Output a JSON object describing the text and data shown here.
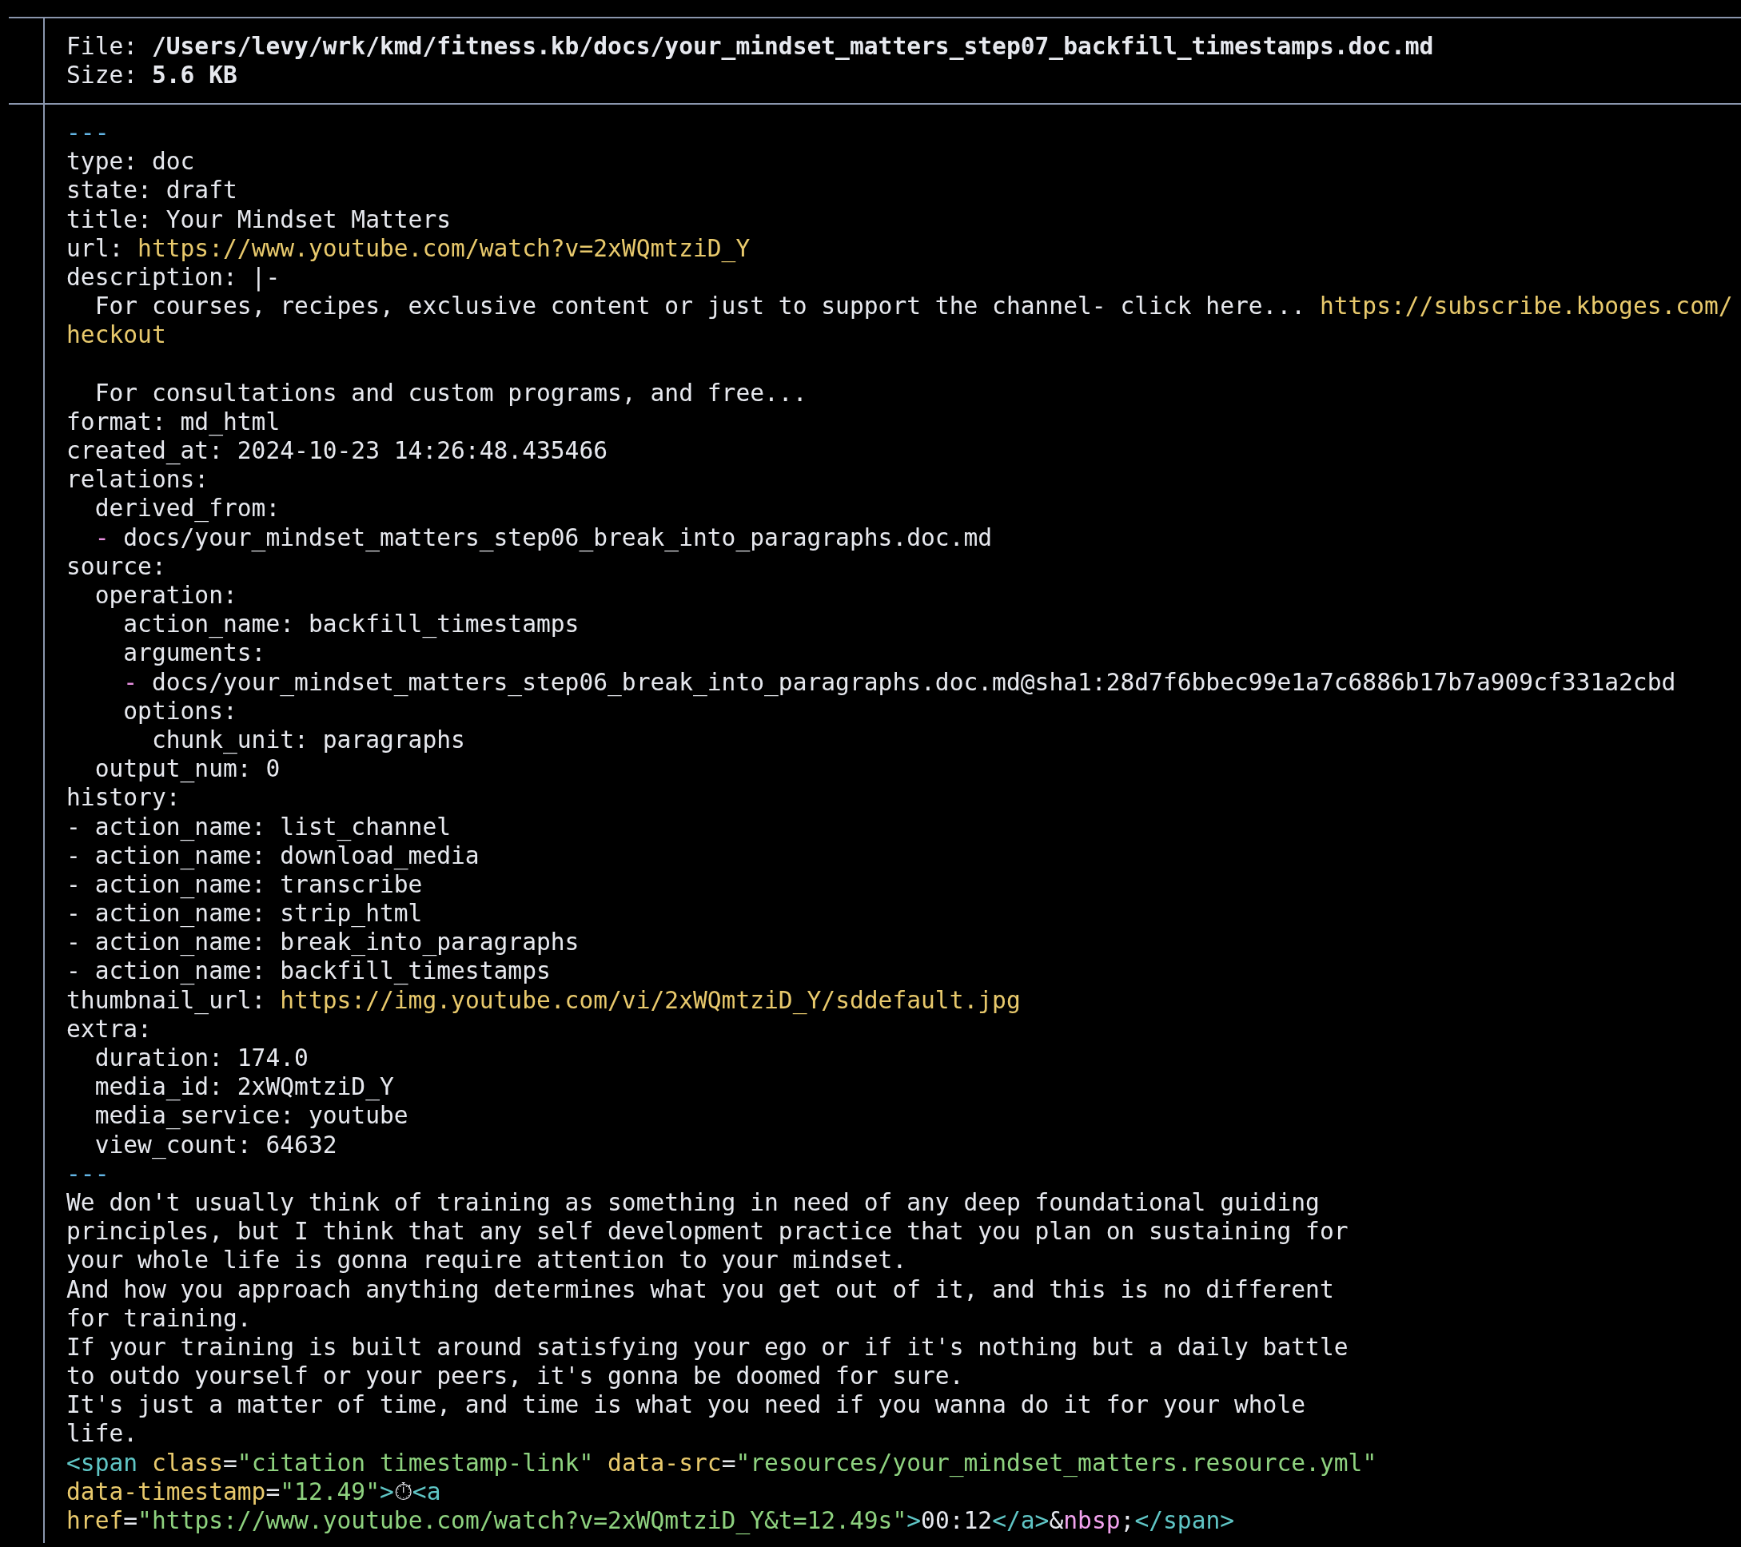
{
  "header": [
    {
      "label": "File:",
      "value": "/Users/levy/wrk/kmd/fitness.kb/docs/your_mindset_matters_step07_backfill_timestamps.doc.md"
    },
    {
      "label": "Size:",
      "value": "5.6 KB"
    }
  ],
  "lines": [
    {
      "kind": "code",
      "segments": [
        {
          "kind": "fence",
          "text": "---"
        }
      ]
    },
    {
      "kind": "code",
      "segments": [
        {
          "kind": "plain",
          "text": "type: doc"
        }
      ]
    },
    {
      "kind": "code",
      "segments": [
        {
          "kind": "plain",
          "text": "state: draft"
        }
      ]
    },
    {
      "kind": "code",
      "segments": [
        {
          "kind": "plain",
          "text": "title: Your Mindset Matters"
        }
      ]
    },
    {
      "kind": "code",
      "segments": [
        {
          "kind": "plain",
          "text": "url: "
        },
        {
          "kind": "url",
          "text": "https://www.youtube.com/watch?v=2xWQmtziD_Y"
        }
      ]
    },
    {
      "kind": "code",
      "segments": [
        {
          "kind": "plain",
          "text": "description: |-"
        }
      ]
    },
    {
      "kind": "code",
      "segments": [
        {
          "kind": "plain",
          "text": "  For courses, recipes, exclusive content or just to support the channel- click here... "
        },
        {
          "kind": "url",
          "text": "https://subscribe.kboges.com/"
        }
      ]
    },
    {
      "kind": "code",
      "segments": [
        {
          "kind": "url",
          "text": "heckout"
        }
      ]
    },
    {
      "kind": "blank"
    },
    {
      "kind": "code",
      "segments": [
        {
          "kind": "plain",
          "text": "  For consultations and custom programs, and free..."
        }
      ]
    },
    {
      "kind": "code",
      "segments": [
        {
          "kind": "plain",
          "text": "format: md_html"
        }
      ]
    },
    {
      "kind": "code",
      "segments": [
        {
          "kind": "plain",
          "text": "created_at: 2024-10-23 14:26:48.435466"
        }
      ]
    },
    {
      "kind": "code",
      "segments": [
        {
          "kind": "plain",
          "text": "relations:"
        }
      ]
    },
    {
      "kind": "code",
      "segments": [
        {
          "kind": "plain",
          "text": "  derived_from:"
        }
      ]
    },
    {
      "kind": "code",
      "segments": [
        {
          "kind": "dash",
          "text": "  -"
        },
        {
          "kind": "plain",
          "text": " docs/your_mindset_matters_step06_break_into_paragraphs.doc.md"
        }
      ]
    },
    {
      "kind": "code",
      "segments": [
        {
          "kind": "plain",
          "text": "source:"
        }
      ]
    },
    {
      "kind": "code",
      "segments": [
        {
          "kind": "plain",
          "text": "  operation:"
        }
      ]
    },
    {
      "kind": "code",
      "segments": [
        {
          "kind": "plain",
          "text": "    action_name: backfill_timestamps"
        }
      ]
    },
    {
      "kind": "code",
      "segments": [
        {
          "kind": "plain",
          "text": "    arguments:"
        }
      ]
    },
    {
      "kind": "code",
      "segments": [
        {
          "kind": "dash",
          "text": "    -"
        },
        {
          "kind": "plain",
          "text": " docs/your_mindset_matters_step06_break_into_paragraphs.doc.md@sha1:28d7f6bbec99e1a7c6886b17b7a909cf331a2cbd"
        }
      ]
    },
    {
      "kind": "code",
      "segments": [
        {
          "kind": "plain",
          "text": "    options:"
        }
      ]
    },
    {
      "kind": "code",
      "segments": [
        {
          "kind": "plain",
          "text": "      chunk_unit: paragraphs"
        }
      ]
    },
    {
      "kind": "code",
      "segments": [
        {
          "kind": "plain",
          "text": "  output_num: 0"
        }
      ]
    },
    {
      "kind": "code",
      "segments": [
        {
          "kind": "plain",
          "text": "history:"
        }
      ]
    },
    {
      "kind": "code",
      "segments": [
        {
          "kind": "plain",
          "text": "- action_name: list_channel"
        }
      ]
    },
    {
      "kind": "code",
      "segments": [
        {
          "kind": "plain",
          "text": "- action_name: download_media"
        }
      ]
    },
    {
      "kind": "code",
      "segments": [
        {
          "kind": "plain",
          "text": "- action_name: transcribe"
        }
      ]
    },
    {
      "kind": "code",
      "segments": [
        {
          "kind": "plain",
          "text": "- action_name: strip_html"
        }
      ]
    },
    {
      "kind": "code",
      "segments": [
        {
          "kind": "plain",
          "text": "- action_name: break_into_paragraphs"
        }
      ]
    },
    {
      "kind": "code",
      "segments": [
        {
          "kind": "plain",
          "text": "- action_name: backfill_timestamps"
        }
      ]
    },
    {
      "kind": "code",
      "segments": [
        {
          "kind": "plain",
          "text": "thumbnail_url: "
        },
        {
          "kind": "url",
          "text": "https://img.youtube.com/vi/2xWQmtziD_Y/sddefault.jpg"
        }
      ]
    },
    {
      "kind": "code",
      "segments": [
        {
          "kind": "plain",
          "text": "extra:"
        }
      ]
    },
    {
      "kind": "code",
      "segments": [
        {
          "kind": "plain",
          "text": "  duration: 174.0"
        }
      ]
    },
    {
      "kind": "code",
      "segments": [
        {
          "kind": "plain",
          "text": "  media_id: 2xWQmtziD_Y"
        }
      ]
    },
    {
      "kind": "code",
      "segments": [
        {
          "kind": "plain",
          "text": "  media_service: youtube"
        }
      ]
    },
    {
      "kind": "code",
      "segments": [
        {
          "kind": "plain",
          "text": "  view_count: 64632"
        }
      ]
    },
    {
      "kind": "code",
      "segments": [
        {
          "kind": "fence",
          "text": "---"
        }
      ]
    },
    {
      "kind": "code",
      "segments": [
        {
          "kind": "plain",
          "text": "We don't usually think of training as something in need of any deep foundational guiding"
        }
      ]
    },
    {
      "kind": "code",
      "segments": [
        {
          "kind": "plain",
          "text": "principles, but I think that any self development practice that you plan on sustaining for"
        }
      ]
    },
    {
      "kind": "code",
      "segments": [
        {
          "kind": "plain",
          "text": "your whole life is gonna require attention to your mindset."
        }
      ]
    },
    {
      "kind": "code",
      "segments": [
        {
          "kind": "plain",
          "text": "And how you approach anything determines what you get out of it, and this is no different"
        }
      ]
    },
    {
      "kind": "code",
      "segments": [
        {
          "kind": "plain",
          "text": "for training."
        }
      ]
    },
    {
      "kind": "code",
      "segments": [
        {
          "kind": "plain",
          "text": "If your training is built around satisfying your ego or if it's nothing but a daily battle"
        }
      ]
    },
    {
      "kind": "code",
      "segments": [
        {
          "kind": "plain",
          "text": "to outdo yourself or your peers, it's gonna be doomed for sure."
        }
      ]
    },
    {
      "kind": "code",
      "segments": [
        {
          "kind": "plain",
          "text": "It's just a matter of time, and time is what you need if you wanna do it for your whole"
        }
      ]
    },
    {
      "kind": "code",
      "segments": [
        {
          "kind": "plain",
          "text": "life."
        }
      ]
    },
    {
      "kind": "code",
      "segments": [
        {
          "kind": "tag",
          "text": "<span"
        },
        {
          "kind": "attr",
          "text": " class"
        },
        {
          "kind": "plain",
          "text": "="
        },
        {
          "kind": "string",
          "text": "\"citation timestamp-link\""
        },
        {
          "kind": "attr",
          "text": " data-src"
        },
        {
          "kind": "plain",
          "text": "="
        },
        {
          "kind": "string",
          "text": "\"resources/your_mindset_matters.resource.yml\""
        }
      ]
    },
    {
      "kind": "code",
      "segments": [
        {
          "kind": "attr",
          "text": "data-timestamp"
        },
        {
          "kind": "plain",
          "text": "="
        },
        {
          "kind": "string",
          "text": "\"12.49\""
        },
        {
          "kind": "tag",
          "text": ">"
        },
        {
          "kind": "plain",
          "text": "⏱"
        },
        {
          "kind": "tag",
          "text": "<a"
        }
      ]
    },
    {
      "kind": "code",
      "segments": [
        {
          "kind": "attr",
          "text": "href"
        },
        {
          "kind": "plain",
          "text": "="
        },
        {
          "kind": "string",
          "text": "\"https://www.youtube.com/watch?v=2xWQmtziD_Y&t=12.49s\""
        },
        {
          "kind": "tag",
          "text": ">"
        },
        {
          "kind": "plain",
          "text": "00:12"
        },
        {
          "kind": "tag",
          "text": "</a>"
        },
        {
          "kind": "plain",
          "text": "&"
        },
        {
          "kind": "entity",
          "text": "nbsp"
        },
        {
          "kind": "plain",
          "text": ";"
        },
        {
          "kind": "tag",
          "text": "</span>"
        }
      ]
    }
  ]
}
